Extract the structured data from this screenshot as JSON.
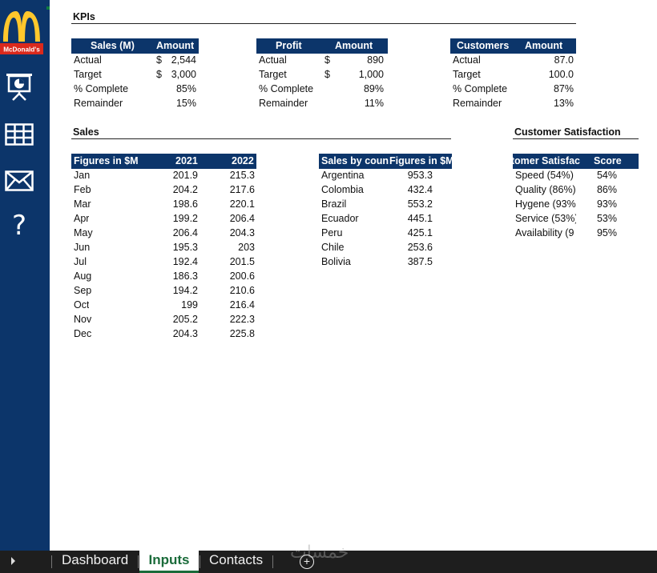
{
  "sidebar": {
    "logo_text": "McDonald's",
    "icons": [
      "presentation-icon",
      "table-icon",
      "mail-icon",
      "help-icon"
    ],
    "help_glyph": "?"
  },
  "colors": {
    "navy": "#0c356a",
    "logo_red": "#da291c",
    "logo_yellow": "#ffc72c",
    "tab_green": "#1a6b3a"
  },
  "kpis": {
    "title": "KPIs",
    "sales": {
      "header": [
        "Sales (M)",
        "Amount"
      ],
      "rows": [
        {
          "label": "Actual",
          "cur": "$",
          "value": "2,544"
        },
        {
          "label": "Target",
          "cur": "$",
          "value": "3,000"
        },
        {
          "label": "% Complete",
          "cur": "",
          "value": "85%"
        },
        {
          "label": "Remainder",
          "cur": "",
          "value": "15%"
        }
      ]
    },
    "profit": {
      "header": [
        "Profit",
        "Amount"
      ],
      "rows": [
        {
          "label": "Actual",
          "cur": "$",
          "value": "890"
        },
        {
          "label": "Target",
          "cur": "$",
          "value": "1,000"
        },
        {
          "label": "% Complete",
          "cur": "",
          "value": "89%"
        },
        {
          "label": "Remainder",
          "cur": "",
          "value": "11%"
        }
      ]
    },
    "customers": {
      "header": [
        "Customers",
        "Amount"
      ],
      "rows": [
        {
          "label": "Actual",
          "value": "87.0"
        },
        {
          "label": "Target",
          "value": "100.0"
        },
        {
          "label": "% Complete",
          "value": "87%"
        },
        {
          "label": "Remainder",
          "value": "13%"
        }
      ]
    }
  },
  "sales": {
    "title": "Sales",
    "monthly": {
      "header": [
        "Figures in $M",
        "2021",
        "2022"
      ],
      "rows": [
        [
          "Jan",
          "201.9",
          "215.3"
        ],
        [
          "Feb",
          "204.2",
          "217.6"
        ],
        [
          "Mar",
          "198.6",
          "220.1"
        ],
        [
          "Apr",
          "199.2",
          "206.4"
        ],
        [
          "May",
          "206.4",
          "204.3"
        ],
        [
          "Jun",
          "195.3",
          "203"
        ],
        [
          "Jul",
          "192.4",
          "201.5"
        ],
        [
          "Aug",
          "186.3",
          "200.6"
        ],
        [
          "Sep",
          "194.2",
          "210.6"
        ],
        [
          "Oct",
          "199",
          "216.4"
        ],
        [
          "Nov",
          "205.2",
          "222.3"
        ],
        [
          "Dec",
          "204.3",
          "225.8"
        ]
      ]
    },
    "by_country": {
      "header": [
        "Sales by count",
        "Figures in $M"
      ],
      "rows": [
        [
          "Argentina",
          "953.3"
        ],
        [
          "Colombia",
          "432.4"
        ],
        [
          "Brazil",
          "553.2"
        ],
        [
          "Ecuador",
          "445.1"
        ],
        [
          "Peru",
          "425.1"
        ],
        [
          "Chile",
          "253.6"
        ],
        [
          "Bolivia",
          "387.5"
        ]
      ]
    }
  },
  "customer_satisfaction": {
    "title": "Customer Satisfaction",
    "header": [
      "tomer Satisfac",
      "Score"
    ],
    "rows": [
      [
        "Speed (54%)",
        "54%"
      ],
      [
        "Quality (86%)",
        "86%"
      ],
      [
        "Hygene (93%",
        "93%"
      ],
      [
        "Service (53%)",
        "53%"
      ],
      [
        "Availability (9",
        "95%"
      ]
    ]
  },
  "tabs": [
    {
      "label": "Dashboard",
      "active": false
    },
    {
      "label": "Inputs",
      "active": true
    },
    {
      "label": "Contacts",
      "active": false
    }
  ],
  "add_sheet_glyph": "+",
  "watermark": "خمسات"
}
